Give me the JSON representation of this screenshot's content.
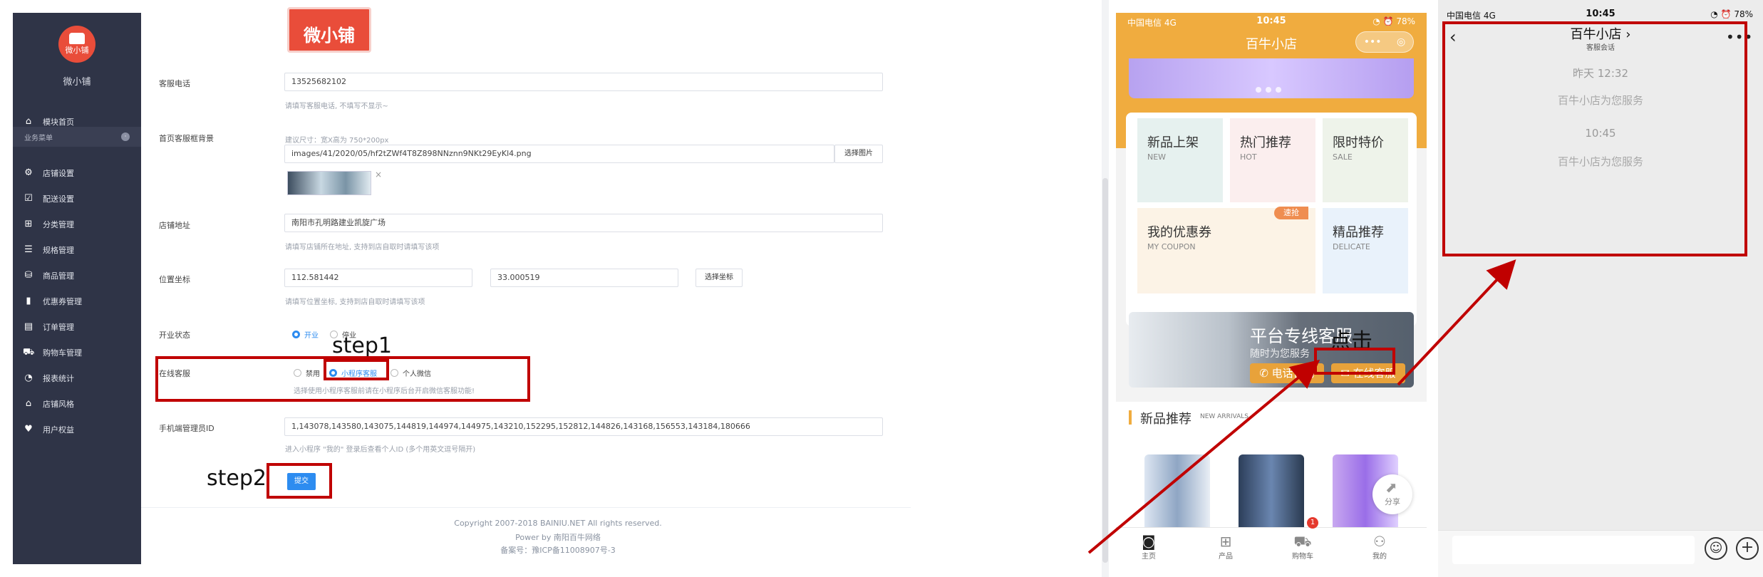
{
  "sidebar": {
    "brand": "微小铺",
    "logo_text": "微小铺",
    "group_label": "业务菜单",
    "items": [
      {
        "label": "模块首页",
        "icon": "home-icon",
        "glyph": "⌂"
      },
      {
        "label": "店铺设置",
        "icon": "gear-icon",
        "glyph": "⚙"
      },
      {
        "label": "配送设置",
        "icon": "checkbox-icon",
        "glyph": "☑"
      },
      {
        "label": "分类管理",
        "icon": "grid-icon",
        "glyph": "⊞"
      },
      {
        "label": "规格管理",
        "icon": "list-icon",
        "glyph": "☰"
      },
      {
        "label": "商品管理",
        "icon": "database-icon",
        "glyph": "⛁"
      },
      {
        "label": "优惠券管理",
        "icon": "coupon-icon",
        "glyph": "▮"
      },
      {
        "label": "订单管理",
        "icon": "order-icon",
        "glyph": "▤"
      },
      {
        "label": "购物车管理",
        "icon": "cart-icon",
        "glyph": "⛟"
      },
      {
        "label": "报表统计",
        "icon": "pie-chart-icon",
        "glyph": "◔"
      },
      {
        "label": "店铺风格",
        "icon": "house-icon",
        "glyph": "⌂"
      },
      {
        "label": "用户权益",
        "icon": "heart-icon",
        "glyph": "♥"
      }
    ]
  },
  "form": {
    "brand_image_text": "微小铺",
    "phone_label": "客服电话",
    "phone_value": "13525682102",
    "phone_hint": "请填写客服电话, 不填写不显示~",
    "bg_label": "首页客服框背景",
    "bg_size_hint": "建议尺寸：宽X高为 750*200px",
    "bg_path": "images/41/2020/05/hf2tZWf4T8Z898NNznn9NKt29EyKl4.png",
    "bg_button": "选择图片",
    "address_label": "店铺地址",
    "address_value": "南阳市孔明路建业凯旋广场",
    "address_hint": "请填写店铺所在地址, 支持到店自取时请填写该项",
    "coord_label": "位置坐标",
    "coord_lng": "112.581442",
    "coord_lat": "33.000519",
    "coord_button": "选择坐标",
    "coord_hint": "请填写位置坐标, 支持到店自取时请填写该项",
    "status_label": "开业状态",
    "status_open": "开业",
    "status_closed": "停业",
    "service_label": "在线客服",
    "service_disabled": "禁用",
    "service_mini": "小程序客服",
    "service_wechat": "个人微信",
    "service_hint": "选择使用小程序客服前请在小程序后台开启微信客服功能!",
    "admin_label": "手机端管理员ID",
    "admin_value": "1,143078,143580,143075,144819,144974,144975,143210,152295,152812,144826,143168,156553,143184,180666",
    "admin_hint": "进入小程序 \"我的\" 登录后查看个人ID (多个用英文逗号隔开)",
    "submit_label": "提交"
  },
  "footer": {
    "copyright": "Copyright 2007-2018 BAINIU.NET All rights reserved.",
    "power": "Power by 南阳百牛网络",
    "icp": "备案号：豫ICP备11008907号-3"
  },
  "annotations": {
    "step1": "step1",
    "step2": "step2",
    "click": "点击"
  },
  "shop_phone": {
    "carrier": "中国电信 4G",
    "time": "10:45",
    "battery": "◔ ⏰ 78%",
    "title": "百牛小店",
    "capsule_dots": "•••",
    "capsule_target": "◎",
    "tiles": [
      {
        "title": "新品上架",
        "sub": "NEW",
        "color": "#e6f1ef"
      },
      {
        "title": "热门推荐",
        "sub": "HOT",
        "color": "#fbeeee"
      },
      {
        "title": "限时特价",
        "sub": "SALE",
        "color": "#eef3ea"
      },
      {
        "title": "我的优惠券",
        "sub": "MY COUPON",
        "color": "#fcf3e6"
      },
      {
        "title": "精品推荐",
        "sub": "DELICATE",
        "color": "#e9f2fb"
      }
    ],
    "coupon_tag": "速抢",
    "service_title": "平台专线客服",
    "service_sub": "随时为您服务",
    "btn_phone": "电话咨询",
    "btn_online": "在线客服",
    "new_title": "新品推荐",
    "new_sub": "NEW ARRIVALS",
    "share": "分享",
    "tabs": [
      {
        "label": "主页",
        "icon": "home-tab-icon",
        "glyph": "◙"
      },
      {
        "label": "产品",
        "icon": "grid-tab-icon",
        "glyph": "⊞"
      },
      {
        "label": "购物车",
        "icon": "cart-tab-icon",
        "glyph": "⛟"
      },
      {
        "label": "我的",
        "icon": "user-tab-icon",
        "glyph": "⚇"
      }
    ],
    "cart_count": "1"
  },
  "chat_phone": {
    "carrier": "中国电信 4G",
    "time": "10:45",
    "battery": "◔ ⏰ 78%",
    "title": "百牛小店 ›",
    "subtitle": "客服会话",
    "back": "‹",
    "more": "•••",
    "messages": [
      {
        "time": "昨天 12:32",
        "text": "百牛小店为您服务"
      },
      {
        "time": "10:45",
        "text": "百牛小店为您服务"
      }
    ],
    "emoji": "☺",
    "plus": "+"
  }
}
